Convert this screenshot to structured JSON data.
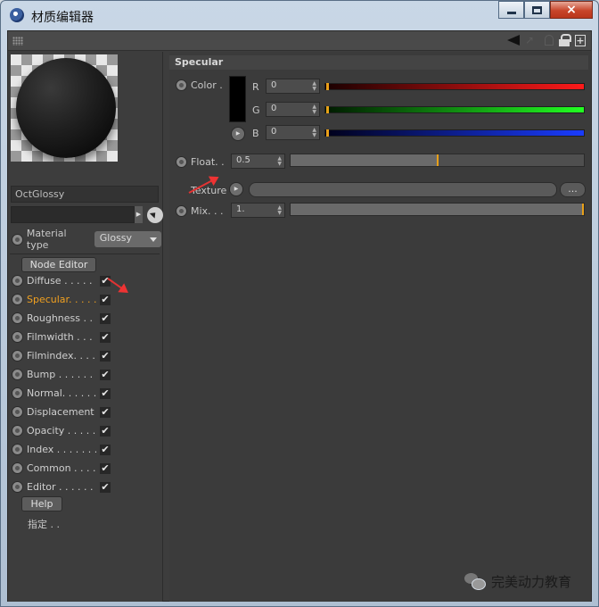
{
  "window": {
    "title": "材质编辑器",
    "close": "×"
  },
  "material": {
    "name": "OctGlossy",
    "type_label": "Material type",
    "type_value": "Glossy"
  },
  "node_editor": "Node Editor",
  "channels": [
    {
      "label": "Diffuse . . . . . .",
      "checked": true,
      "active": false
    },
    {
      "label": "Specular. . . . .",
      "checked": true,
      "active": true
    },
    {
      "label": "Roughness . .",
      "checked": true,
      "active": false
    },
    {
      "label": "Filmwidth . . .",
      "checked": true,
      "active": false
    },
    {
      "label": "Filmindex. . . .",
      "checked": true,
      "active": false
    },
    {
      "label": "Bump . . . . . . .",
      "checked": true,
      "active": false
    },
    {
      "label": "Normal. . . . . .",
      "checked": true,
      "active": false
    },
    {
      "label": "Displacement",
      "checked": true,
      "active": false
    },
    {
      "label": "Opacity . . . . .",
      "checked": true,
      "active": false
    },
    {
      "label": "Index . . . . . . .",
      "checked": true,
      "active": false
    },
    {
      "label": "Common . . . .",
      "checked": true,
      "active": false
    },
    {
      "label": "Editor . . . . . . .",
      "checked": true,
      "active": false
    }
  ],
  "check_glyph": "✔",
  "help": "Help",
  "hint": "指定 . .",
  "specular": {
    "title": "Specular",
    "color_label": "Color .",
    "r_label": "R",
    "r_value": "0",
    "g_label": "G",
    "g_value": "0",
    "b_label": "B",
    "b_value": "0",
    "swatch_color": "#000000",
    "float_label": "Float. .",
    "float_value": "0.5",
    "float_fraction": 0.5,
    "texture_label": "Texture",
    "more": "...",
    "mix_label": "Mix. . .",
    "mix_value": "1.",
    "mix_fraction": 1.0
  },
  "colors": {
    "accent": "#e8a019",
    "red": "#ff1a1a",
    "green": "#22ff22",
    "blue": "#1a3cff",
    "arrow": "#e33333"
  },
  "watermark": "完美动力教育"
}
